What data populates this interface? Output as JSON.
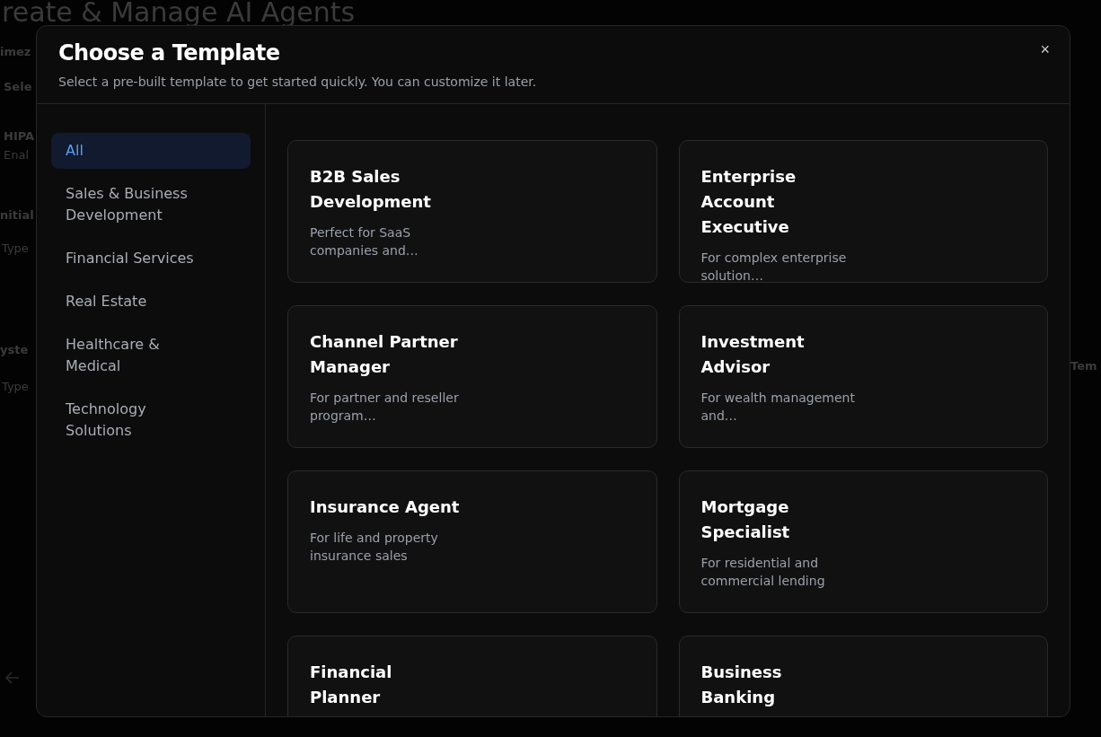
{
  "background": {
    "heading": "reate & Manage AI Agents",
    "left_fragments": [
      "imez",
      "Sele",
      "HIPA",
      "Enal",
      "nitial",
      "Type",
      "yste",
      "Type"
    ],
    "right_fragment": "Tem"
  },
  "dialog": {
    "title": "Choose a Template",
    "subtitle": "Select a pre-built template to get started quickly. You can customize it later.",
    "close": "×",
    "categories": [
      {
        "label": "All",
        "selected": true
      },
      {
        "label": "Sales & Business Development",
        "selected": false
      },
      {
        "label": "Financial Services",
        "selected": false
      },
      {
        "label": "Real Estate",
        "selected": false
      },
      {
        "label": "Healthcare & Medical",
        "selected": false
      },
      {
        "label": "Technology Solutions",
        "selected": false
      }
    ],
    "templates": [
      {
        "title": "B2B Sales Development",
        "description": "Perfect for SaaS companies and…"
      },
      {
        "title": "Enterprise Account Executive",
        "description": "For complex enterprise solution…"
      },
      {
        "title": "Channel Partner Manager",
        "description": "For partner and reseller program…"
      },
      {
        "title": "Investment Advisor",
        "description": "For wealth management and…"
      },
      {
        "title": "Insurance Agent",
        "description": "For life and property insurance sales"
      },
      {
        "title": "Mortgage Specialist",
        "description": "For residential and commercial lending"
      },
      {
        "title": "Financial Planner"
      },
      {
        "title": "Business Banking"
      }
    ]
  }
}
